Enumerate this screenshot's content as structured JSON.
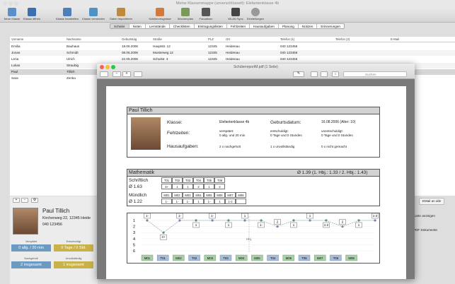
{
  "window": {
    "title": "Meine Klassenmappe (unverschlüsselt): Elefantenklasse 4b"
  },
  "toolbar": [
    {
      "label": "Neue Klasse",
      "icon": "new-class-icon"
    },
    {
      "label": "Klasse öffnen",
      "icon": "open-class-icon"
    },
    {
      "label": "Klasse bearbeiten",
      "icon": "edit-class-icon"
    },
    {
      "label": "Klasse versenden",
      "icon": "send-class-icon"
    },
    {
      "label": "Daten importieren",
      "icon": "import-icon"
    },
    {
      "label": "Schülerzeugnisse",
      "icon": "students-icon"
    },
    {
      "label": "Wochenplan",
      "icon": "weekplan-icon"
    },
    {
      "label": "Fotoalbum",
      "icon": "photo-icon"
    },
    {
      "label": "WLAN Sync",
      "icon": "sync-icon"
    },
    {
      "label": "Einstellungen",
      "icon": "gear-icon"
    }
  ],
  "tabs": [
    "Schüler",
    "Noten",
    "Lernstände",
    "Checklisten",
    "Eintragungslisten",
    "Fehlzeiten",
    "Hausaufgaben",
    "Planung",
    "Notizen",
    "Erinnerungen"
  ],
  "table": {
    "columns": [
      "Vorname",
      "Nachname",
      "Geburtstag",
      "Straße",
      "PLZ",
      "Ort",
      "Telefon (1)",
      "Telefon (2)",
      "E-Mail"
    ],
    "rows": [
      [
        "Emilia",
        "Bauhaus",
        "18.06.2006",
        "Hauptstr. 12",
        "12345",
        "Heidenau",
        "040 123456",
        "",
        ""
      ],
      [
        "Jonas",
        "Schmidt",
        "08.06.2006",
        "Musterweg 12",
        "12345",
        "Heidenau",
        "040 123456",
        "",
        ""
      ],
      [
        "Lena",
        "Ulrich",
        "22.05.2006",
        "Schulstr. 3",
        "12345",
        "Heidenau",
        "040 123456",
        "",
        ""
      ],
      [
        "Lukas",
        "Straubig",
        "",
        "",
        "",
        "",
        "",
        "",
        ""
      ],
      [
        "Paul",
        "Tillich",
        "",
        "",
        "",
        "",
        "",
        "",
        ""
      ],
      [
        "Sara",
        "Zenka",
        "",
        "",
        "",
        "",
        "",
        "",
        ""
      ]
    ]
  },
  "student_panel": {
    "name": "Paul Tillich",
    "address": "Kirchenweg 22, 12345 Heide",
    "phone": "040 123456",
    "stats": [
      {
        "label": "Verspätet",
        "value": "0 allg. / 20 min",
        "color": "#6d9ac0"
      },
      {
        "label": "Entschuldigt",
        "value": "0 Tage / 0 Std.",
        "color": "#c9b24a"
      },
      {
        "label": "Nachgeholt",
        "value": "2 insgesamt",
        "color": "#6d9ac0"
      },
      {
        "label": "Unvollständig",
        "value": "1 insgesamt",
        "color": "#c9b24a"
      }
    ],
    "email_button": "EMail an alle",
    "print_button": "Karte anzeigen",
    "pdf_button": "PDF Dokumente"
  },
  "preview": {
    "title": "SchülerreportM.pdf (1 Seite)",
    "search_placeholder": "Suchen",
    "report": {
      "name": "Paul Tillich",
      "class_label": "Klasse:",
      "class_value": "Elefantenklasse 4b",
      "birth_label": "Geburtsdatum:",
      "birth_value": "16.08.2006 (Alter: 10)",
      "absence_label": "Fehlzeiten:",
      "absence_late": "verspätet:\n0 allg. und 20 min",
      "absence_excused": "entschuldigt:\n0 Tage und 0 Stunden",
      "absence_unexcused": "unentschuldigt:\n0 Tage und 0 Stunden",
      "homework_label": "Hausaufgaben:",
      "homework_done": "2 x nachgeholt",
      "homework_incomplete": "1 x unvollständig",
      "homework_missing": "0 x nicht gemacht",
      "subject": "Mathematik",
      "subject_avg": "Ø 1.39 (1. Hbj.: 1.33 / 2. Hbj.: 1.43)",
      "written_label": "Schriftlich",
      "written_avg": "Ø 1.63",
      "written_cols": [
        "T01",
        "T02",
        "T03",
        "T04",
        "T05",
        "T06"
      ],
      "written_vals": [
        "3+",
        "1",
        "1",
        "2",
        "1",
        "2"
      ],
      "oral_label": "Mündlich",
      "oral_avg": "Ø 1.22",
      "oral_cols": [
        "M01",
        "M02",
        "M03",
        "M04",
        "M05",
        "M06",
        "M07",
        "M08"
      ],
      "oral_vals": [
        "1-",
        "1-",
        "1-",
        "1",
        "1-",
        "1",
        "1-2",
        ""
      ],
      "chart_axis": [
        "1",
        "2",
        "3",
        "4",
        "5",
        "6"
      ],
      "chart_divider": "Hbj.",
      "chart_labels": [
        "M01",
        "T01",
        "M02",
        "T02",
        "M03",
        "T03",
        "M04",
        "M05",
        "T04",
        "M06",
        "T05",
        "M07",
        "T06",
        "M08"
      ],
      "chart_bubbles": [
        "1-",
        "3+",
        "1-",
        "1",
        "1-",
        "1",
        "1",
        "1-",
        "2",
        "1",
        "1",
        "1-2",
        "2",
        "1",
        "1-2"
      ]
    }
  }
}
